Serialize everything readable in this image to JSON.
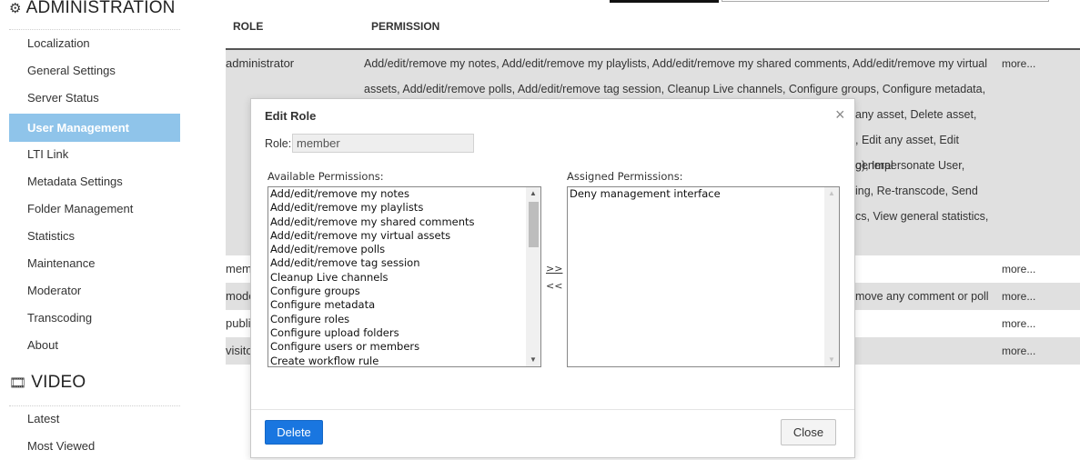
{
  "sidebar": {
    "admin_title": "ADMINISTRATION",
    "admin_icon": "gear-icon",
    "items": [
      {
        "label": "Localization"
      },
      {
        "label": "General Settings"
      },
      {
        "label": "Server Status"
      },
      {
        "label": "User Management",
        "active": true
      },
      {
        "label": "LTI Link"
      },
      {
        "label": "Metadata Settings"
      },
      {
        "label": "Folder Management"
      },
      {
        "label": "Statistics"
      },
      {
        "label": "Maintenance"
      },
      {
        "label": "Moderator"
      },
      {
        "label": "Transcoding"
      },
      {
        "label": "About"
      }
    ],
    "video_title": "VIDEO",
    "video_icon": "film-icon",
    "video_items": [
      {
        "label": "Latest"
      },
      {
        "label": "Most Viewed"
      }
    ]
  },
  "table": {
    "headers": {
      "role": "ROLE",
      "permission": "PERMISSION"
    },
    "rows": [
      {
        "role": "administrator",
        "permission_lines": [
          "Add/edit/remove my notes, Add/edit/remove my playlists, Add/edit/remove my shared comments, Add/edit/remove my virtual",
          "assets, Add/edit/remove polls, Add/edit/remove tag session, Cleanup Live channels, Configure groups, Configure metadata,",
          "any asset, Delete asset,",
          ", Edit any asset, Edit general",
          "o), Impersonate User,",
          "ing, Re-transcode, Send",
          "cs, View general statistics,"
        ],
        "more": "more..."
      },
      {
        "role": "mem",
        "permission_lines": [
          ""
        ],
        "more": "more..."
      },
      {
        "role": "mode",
        "permission_lines": [
          "move any comment or poll"
        ],
        "more": "more..."
      },
      {
        "role": "publi",
        "permission_lines": [
          ""
        ],
        "more": "more..."
      },
      {
        "role": "visito",
        "permission_lines": [
          ""
        ],
        "more": "more..."
      }
    ]
  },
  "modal": {
    "title": "Edit Role",
    "role_label": "Role:",
    "role_value": "member",
    "available_label": "Available Permissions:",
    "assigned_label": "Assigned Permissions:",
    "available": [
      "Add/edit/remove my notes",
      "Add/edit/remove my playlists",
      "Add/edit/remove my shared comments",
      "Add/edit/remove my virtual assets",
      "Add/edit/remove polls",
      "Add/edit/remove tag session",
      "Cleanup Live channels",
      "Configure groups",
      "Configure metadata",
      "Configure roles",
      "Configure upload folders",
      "Configure users or members",
      "Create workflow rule"
    ],
    "assigned": [
      "Deny management interface"
    ],
    "add_label": ">>",
    "remove_label": "<<",
    "delete_label": "Delete",
    "close_label": "Close",
    "close_glyph": "×"
  }
}
